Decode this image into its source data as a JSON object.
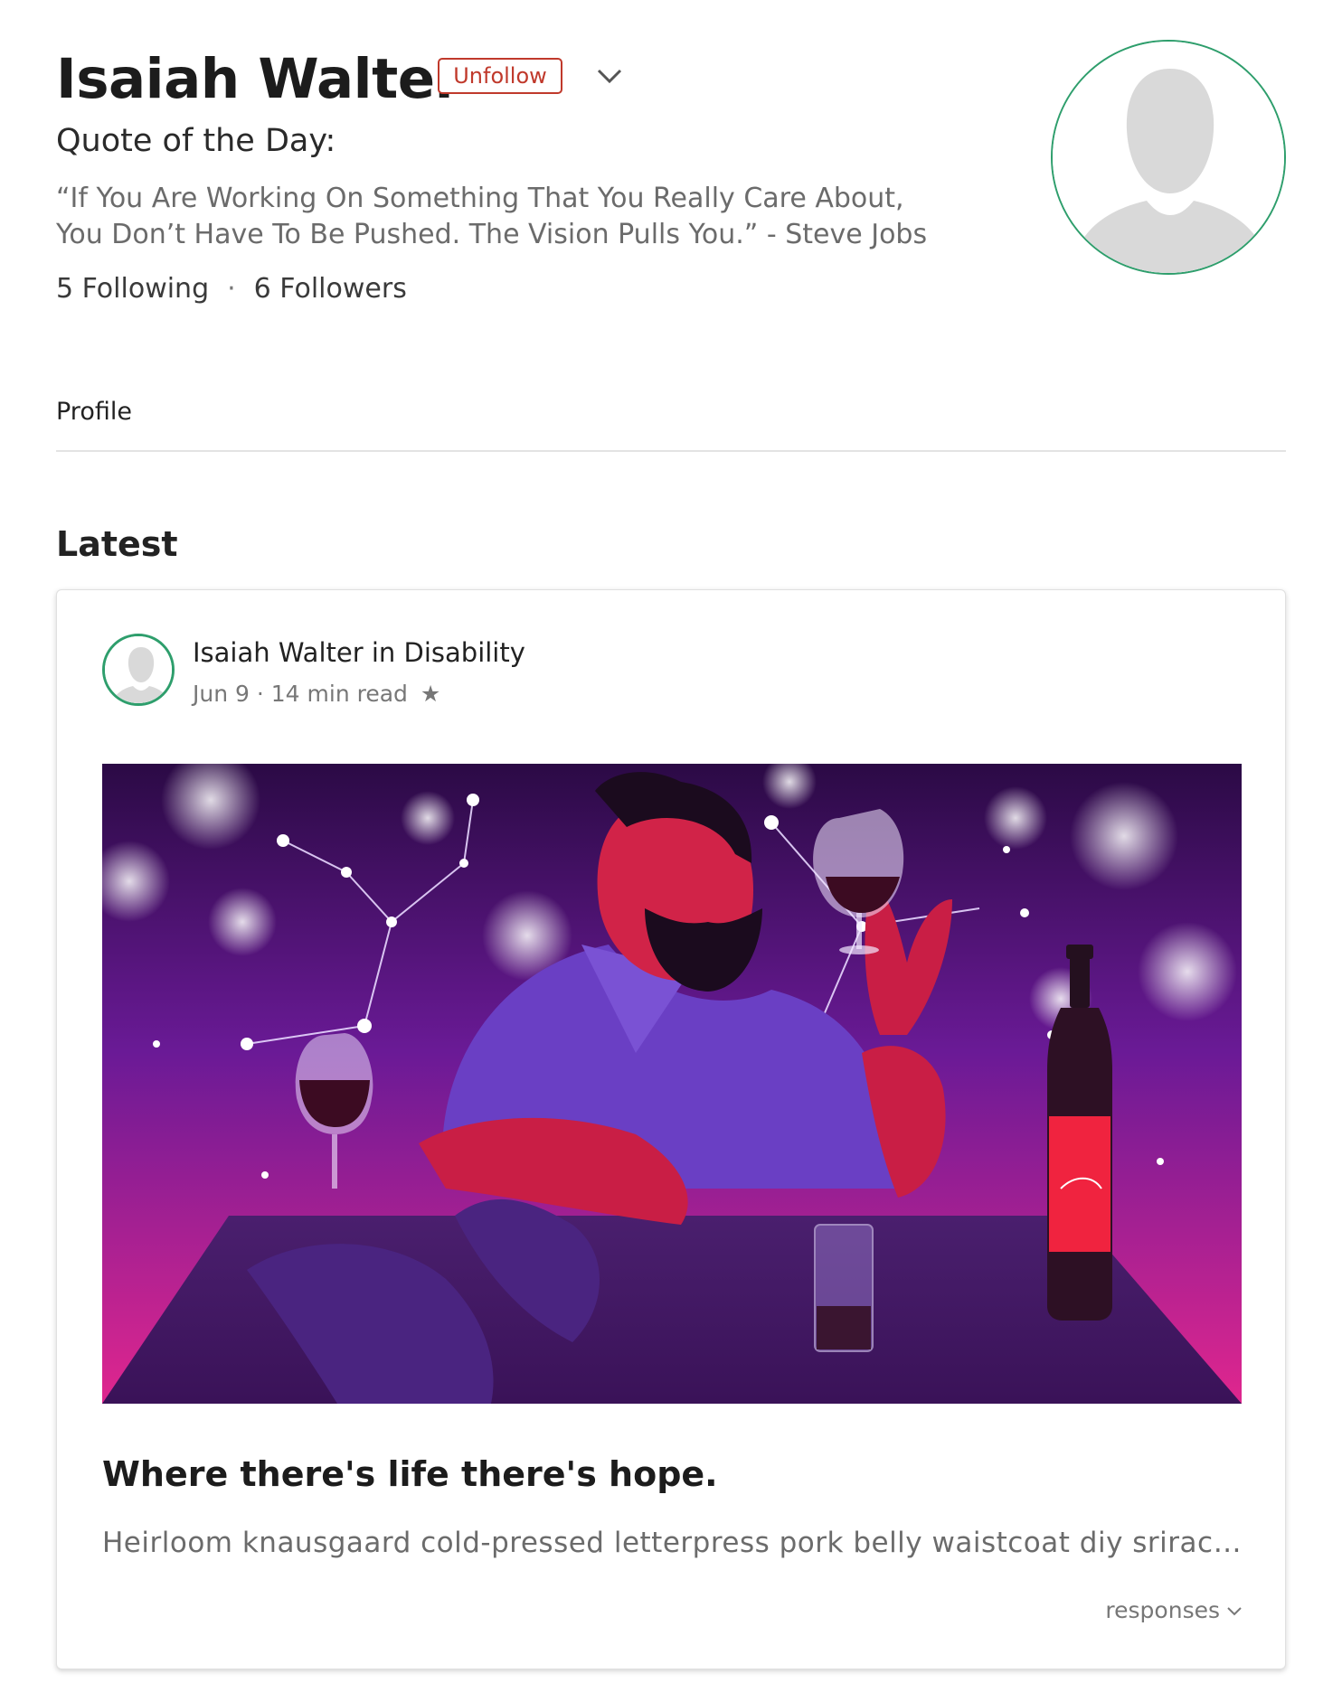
{
  "profile": {
    "name": "Isaiah Walter",
    "unfollow_label": "Unfollow",
    "quote_title": "Quote of the Day:",
    "quote_line1": "“If You Are Working On Something That You Really Care About,",
    "quote_line2": "You Don’t Have To Be Pushed. The Vision Pulls You.” - Steve Jobs",
    "following": "5 Following",
    "separator": "·",
    "followers": "6 Followers",
    "accent_color": "#2e9e6c",
    "unfollow_color": "#c0392b"
  },
  "tabs": {
    "profile_label": "Profile"
  },
  "section": {
    "latest_label": "Latest"
  },
  "post": {
    "author_line": "Isaiah Walter in Disability",
    "date": "Jun 9",
    "meta_sep": "·",
    "read_time": "14 min read",
    "star_icon": "★",
    "title": "Where there's life there's hope.",
    "excerpt": "Heirloom knausgaard cold-pressed letterpress pork belly waistcoat diy sriracha",
    "responses_label": "responses"
  }
}
